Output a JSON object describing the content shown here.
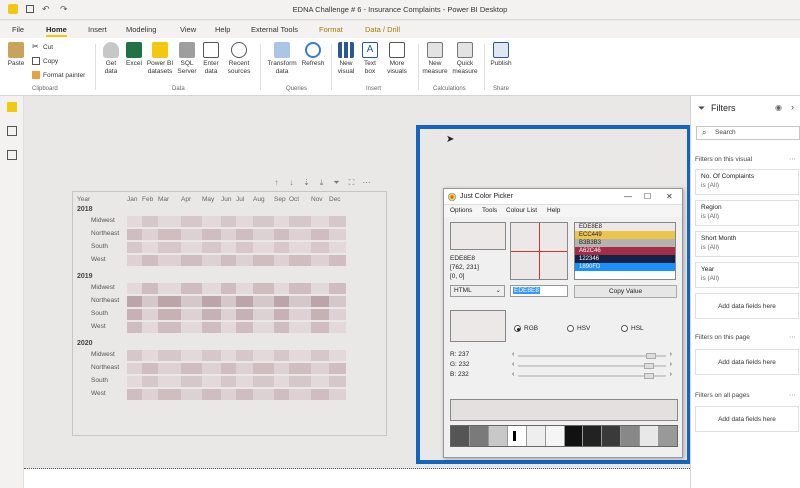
{
  "window": {
    "title": "EDNA Challenge # 6 - Insurance Complaints - Power BI Desktop"
  },
  "tabs": [
    "File",
    "Home",
    "Insert",
    "Modeling",
    "View",
    "Help",
    "External Tools",
    "Format",
    "Data / Drill"
  ],
  "ribbon": {
    "clipboard": {
      "paste": "Paste",
      "cut": "Cut",
      "copy": "Copy",
      "format_painter": "Format painter",
      "label": "Clipboard"
    },
    "data": {
      "get_data": "Get data",
      "excel": "Excel",
      "pbi_datasets": "Power BI datasets",
      "sql": "SQL Server",
      "enter_data": "Enter data",
      "recent": "Recent sources",
      "label": "Data"
    },
    "queries": {
      "transform": "Transform data",
      "refresh": "Refresh",
      "label": "Queries"
    },
    "insert": {
      "new_visual": "New visual",
      "text_box": "Text box",
      "more_visuals": "More visuals",
      "label": "Insert"
    },
    "calculations": {
      "new_measure": "New measure",
      "quick_measure": "Quick measure",
      "label": "Calculations"
    },
    "share": {
      "publish": "Publish",
      "label": "Share"
    }
  },
  "matrix": {
    "header_year": "Year",
    "months": [
      "Jan",
      "Feb",
      "Mar",
      "Apr",
      "May",
      "Jun",
      "Jul",
      "Aug",
      "Sep",
      "Oct",
      "Nov",
      "Dec"
    ],
    "years": [
      {
        "year": "2018",
        "regions": [
          "Midwest",
          "Northeast",
          "South",
          "West"
        ]
      },
      {
        "year": "2019",
        "regions": [
          "Midwest",
          "Northeast",
          "South",
          "West"
        ]
      },
      {
        "year": "2020",
        "regions": [
          "Midwest",
          "Northeast",
          "South",
          "West"
        ]
      }
    ]
  },
  "picker": {
    "title": "Just Color Picker",
    "menu": [
      "Options",
      "Tools",
      "Colour List",
      "Help"
    ],
    "current_hex": "EDE8E8",
    "coords": "[762, 231]",
    "offset": "[0, 0]",
    "list": [
      {
        "hex": "EDE8E8",
        "color": "#ede8e8",
        "fg": "#222"
      },
      {
        "hex": "ECC449",
        "color": "#ecc449",
        "fg": "#222"
      },
      {
        "hex": "B3B3B3",
        "color": "#b3b3b3",
        "fg": "#222"
      },
      {
        "hex": "A62C46",
        "color": "#a62c46",
        "fg": "#fff"
      },
      {
        "hex": "122346",
        "color": "#122346",
        "fg": "#fff"
      },
      {
        "hex": "1890FD",
        "color": "#1890fd",
        "fg": "#fff"
      }
    ],
    "format": "HTML",
    "input_value": "EDE8E8",
    "copy_label": "Copy Value",
    "modes": [
      "RGB",
      "HSV",
      "HSL"
    ],
    "r_label": "R: 237",
    "g_label": "G: 232",
    "b_label": "B: 232",
    "r": 237,
    "g": 232,
    "b": 232
  },
  "filters": {
    "title": "Filters",
    "search": "Search",
    "on_visual": "Filters on this visual",
    "cards": [
      {
        "name": "No. Of Complaints",
        "value": "is (All)"
      },
      {
        "name": "Region",
        "value": "is (All)"
      },
      {
        "name": "Short Month",
        "value": "is (All)"
      },
      {
        "name": "Year",
        "value": "is (All)"
      }
    ],
    "add_fields": "Add data fields here",
    "on_page": "Filters on this page",
    "on_all": "Filters on all pages"
  }
}
